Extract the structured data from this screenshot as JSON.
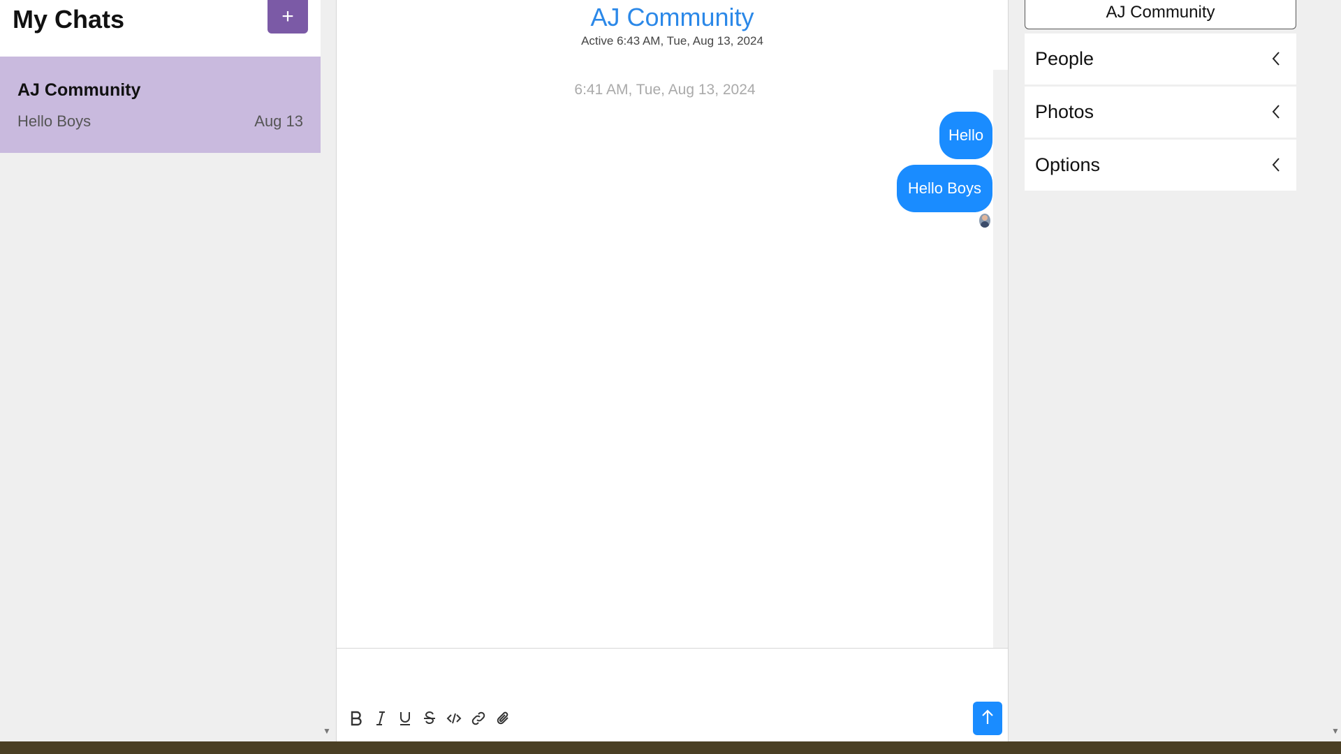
{
  "sidebar": {
    "title": "My Chats",
    "new_chat_label": "+",
    "chats": [
      {
        "title": "AJ Community",
        "preview": "Hello Boys",
        "date": "Aug 13"
      }
    ]
  },
  "chat": {
    "title": "AJ Community",
    "subtitle": "Active 6:43 AM, Tue, Aug 13, 2024",
    "timestamp": "6:41 AM, Tue, Aug 13, 2024",
    "messages": [
      {
        "text": "Hello"
      },
      {
        "text": "Hello Boys"
      }
    ],
    "toolbar_icons": [
      "bold-icon",
      "italic-icon",
      "underline-icon",
      "strikethrough-icon",
      "code-icon",
      "link-icon",
      "attachment-icon"
    ],
    "send_icon": "arrow-up-icon",
    "accent_color": "#1a8cff"
  },
  "details": {
    "title": "AJ Community",
    "sections": [
      {
        "label": "People"
      },
      {
        "label": "Photos"
      },
      {
        "label": "Options"
      }
    ]
  },
  "colors": {
    "brand_purple": "#7b5aa6",
    "selected_chat": "#c9bade",
    "title_blue": "#2b88e8"
  }
}
